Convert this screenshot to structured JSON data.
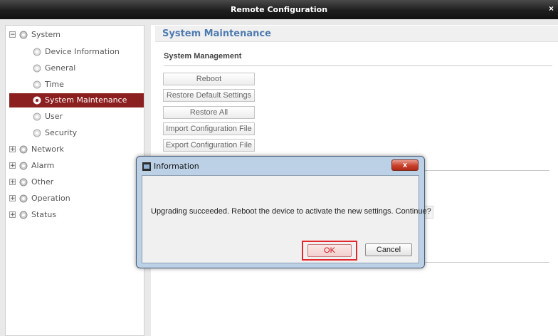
{
  "window": {
    "title": "Remote Configuration",
    "close_glyph": "×"
  },
  "sidebar": {
    "items": [
      {
        "label": "System",
        "expander": "−",
        "level": 0,
        "selected": false
      },
      {
        "label": "Device Information",
        "level": 1,
        "selected": false
      },
      {
        "label": "General",
        "level": 1,
        "selected": false
      },
      {
        "label": "Time",
        "level": 1,
        "selected": false
      },
      {
        "label": "System Maintenance",
        "level": 1,
        "selected": true
      },
      {
        "label": "User",
        "level": 1,
        "selected": false
      },
      {
        "label": "Security",
        "level": 1,
        "selected": false
      },
      {
        "label": "Network",
        "expander": "+",
        "level": 0,
        "selected": false
      },
      {
        "label": "Alarm",
        "expander": "+",
        "level": 0,
        "selected": false
      },
      {
        "label": "Other",
        "expander": "+",
        "level": 0,
        "selected": false
      },
      {
        "label": "Operation",
        "expander": "+",
        "level": 0,
        "selected": false
      },
      {
        "label": "Status",
        "expander": "+",
        "level": 0,
        "selected": false
      }
    ]
  },
  "main": {
    "section_title": "System Maintenance",
    "system_management": {
      "title": "System Management",
      "buttons": {
        "reboot": "Reboot",
        "restore_default": "Restore Default Settings",
        "restore_all": "Restore All",
        "import_config": "Import Configuration File",
        "export_config": "Export Configuration File"
      }
    }
  },
  "dialog": {
    "title": "Information",
    "close_glyph": "x",
    "message": "Upgrading succeeded. Reboot the device to activate the new settings. Continue?",
    "ok_label": "OK",
    "cancel_label": "Cancel"
  },
  "colors": {
    "selected_bg": "#8c1f1f",
    "section_title": "#4f7bb0",
    "highlight_border": "#e5262f"
  }
}
